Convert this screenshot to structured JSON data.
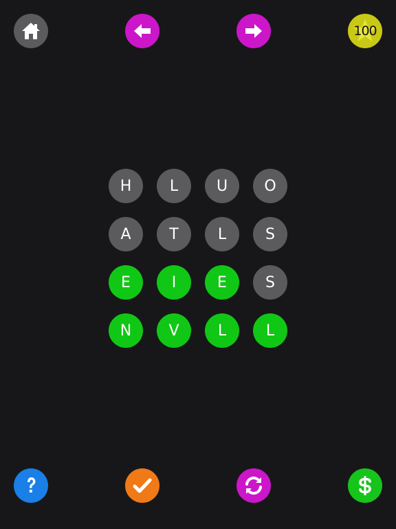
{
  "top_bar": {
    "score": "100",
    "icons": {
      "home": "home-icon",
      "prev": "arrow-left-icon",
      "next": "arrow-right-icon",
      "score": "star-icon"
    }
  },
  "grid": {
    "rows": [
      [
        {
          "letter": "H",
          "state": "gray"
        },
        {
          "letter": "L",
          "state": "gray"
        },
        {
          "letter": "U",
          "state": "gray"
        },
        {
          "letter": "O",
          "state": "gray"
        }
      ],
      [
        {
          "letter": "A",
          "state": "gray"
        },
        {
          "letter": "T",
          "state": "gray"
        },
        {
          "letter": "L",
          "state": "gray"
        },
        {
          "letter": "S",
          "state": "gray"
        }
      ],
      [
        {
          "letter": "E",
          "state": "green"
        },
        {
          "letter": "I",
          "state": "green"
        },
        {
          "letter": "E",
          "state": "green"
        },
        {
          "letter": "S",
          "state": "gray"
        }
      ],
      [
        {
          "letter": "N",
          "state": "green"
        },
        {
          "letter": "V",
          "state": "green"
        },
        {
          "letter": "L",
          "state": "green"
        },
        {
          "letter": "L",
          "state": "green"
        }
      ]
    ]
  },
  "bottom_bar": {
    "icons": {
      "help": "question-mark-icon",
      "check": "checkmark-icon",
      "refresh": "refresh-icon",
      "shop": "dollar-icon"
    }
  },
  "colors": {
    "background": "#171719",
    "tile_gray": "#5b5a5d",
    "tile_green": "#10c715",
    "magenta": "#cc16c9",
    "yellow": "#c8c816",
    "blue": "#1a7fe6",
    "orange": "#f07a17",
    "green": "#17c41b"
  }
}
